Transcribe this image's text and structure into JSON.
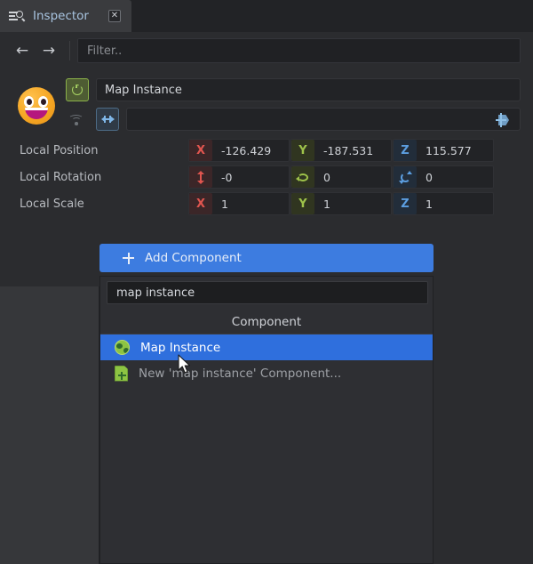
{
  "window": {
    "tab": {
      "icon": "inspector-search-icon",
      "label": "Inspector",
      "close_label": "✕"
    }
  },
  "toolbar": {
    "back_label": "←",
    "forward_label": "→",
    "filter_placeholder": "Filter..",
    "filter_value": ""
  },
  "header": {
    "avatar_icon": "smiley-emoji-avatar",
    "power_icon": "power-toggle-icon",
    "name_value": "Map Instance",
    "wifi_icon": "wifi-icon",
    "link_icon": "link-resize-icon",
    "tag_value": "",
    "tag_icon": "add-tag-icon"
  },
  "transform": {
    "rows": [
      {
        "label": "Local Position",
        "fields": [
          {
            "axis": "X",
            "badge": "x",
            "glyph": "letter",
            "value": "-126.429"
          },
          {
            "axis": "Y",
            "badge": "y",
            "glyph": "letter",
            "value": "-187.531"
          },
          {
            "axis": "Z",
            "badge": "z",
            "glyph": "letter",
            "value": "115.577"
          }
        ]
      },
      {
        "label": "Local Rotation",
        "fields": [
          {
            "axis": "pitch",
            "badge": "x",
            "glyph": "pitch-arrow-icon",
            "value": "-0"
          },
          {
            "axis": "yaw",
            "badge": "y",
            "glyph": "yaw-arrow-icon",
            "value": "0"
          },
          {
            "axis": "roll",
            "badge": "z",
            "glyph": "roll-arrow-icon",
            "value": "0"
          }
        ]
      },
      {
        "label": "Local Scale",
        "fields": [
          {
            "axis": "X",
            "badge": "x",
            "glyph": "letter",
            "value": "1"
          },
          {
            "axis": "Y",
            "badge": "y",
            "glyph": "letter",
            "value": "1"
          },
          {
            "axis": "Z",
            "badge": "z",
            "glyph": "letter",
            "value": "1"
          }
        ]
      }
    ]
  },
  "add_component": {
    "icon": "plus-icon",
    "label": "Add Component"
  },
  "dropdown": {
    "search_value": "map instance",
    "header": "Component",
    "items": [
      {
        "icon": "globe-icon",
        "label": "Map Instance",
        "selected": true
      },
      {
        "icon": "new-document-icon",
        "label": "New 'map instance' Component...",
        "selected": false
      }
    ]
  },
  "cursor": {
    "icon": "mouse-pointer-icon"
  },
  "colors": {
    "accent_blue": "#3d7ce0",
    "selection_blue": "#2f6fdd",
    "axis_x_red": "#e0554f",
    "axis_y_green": "#9ec24a",
    "axis_z_blue": "#5c9ee0",
    "power_green": "#8bb14a",
    "panel_bg": "#2b2c2f",
    "tab_bg": "#3a3b3e",
    "field_bg": "#222326"
  }
}
